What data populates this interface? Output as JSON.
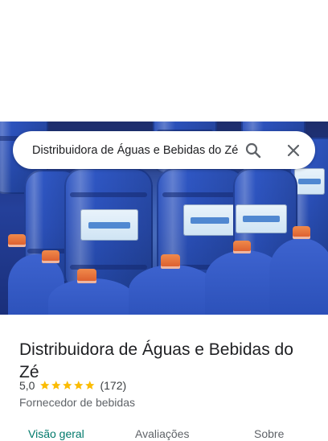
{
  "search": {
    "value": "Distribuidora de Águas e Bebidas do Zé",
    "search_icon": "search-icon",
    "close_icon": "close-icon"
  },
  "hero": {
    "image": "photo of stacked blue 20L water jugs with orange caps"
  },
  "place": {
    "name": "Distribuidora de Águas e Bebidas do Zé",
    "rating": "5,0",
    "stars": 5,
    "review_count": "(172)",
    "category": "Fornecedor de bebidas"
  },
  "tabs": [
    {
      "label": "Visão geral",
      "active": true
    },
    {
      "label": "Avaliações",
      "active": false
    },
    {
      "label": "Sobre",
      "active": false
    }
  ],
  "colors": {
    "accent": "#00796b",
    "star": "#fbbc04",
    "text_primary": "#202124",
    "text_secondary": "#5f6368"
  }
}
